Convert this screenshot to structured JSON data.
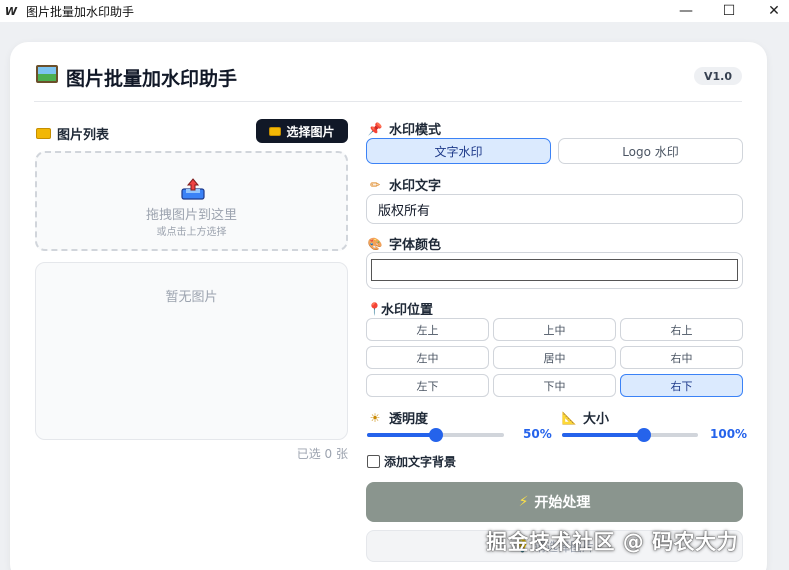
{
  "window": {
    "title": "图片批量加水印助手",
    "icon_glyph": "W",
    "minimize_glyph": "—",
    "maximize_glyph": "☐",
    "close_glyph": "✕"
  },
  "header": {
    "title": "图片批量加水印助手",
    "version": "V1.0"
  },
  "image_list": {
    "label": "图片列表",
    "select_button": "选择图片",
    "dropzone_title": "拖拽图片到这里",
    "dropzone_subtitle": "或点击上方选择",
    "empty_text": "暂无图片",
    "selected_count": "已选 0 张"
  },
  "watermark_mode": {
    "label": "水印模式",
    "options": [
      "文字水印",
      "Logo 水印"
    ],
    "active": "文字水印"
  },
  "watermark_text": {
    "label": "水印文字",
    "value": "版权所有"
  },
  "font_color": {
    "label": "字体颜色",
    "value": "#ffffff"
  },
  "position": {
    "label": "水印位置",
    "options": [
      "左上",
      "上中",
      "右上",
      "左中",
      "居中",
      "右中",
      "左下",
      "下中",
      "右下"
    ],
    "active": "右下"
  },
  "opacity": {
    "label": "透明度",
    "value_text": "50%",
    "value": 0.5
  },
  "size": {
    "label": "大小",
    "value_text": "100%",
    "value": 0.6
  },
  "text_background": {
    "label": "添加文字背景",
    "checked": false
  },
  "start_button": {
    "label": "开始处理"
  },
  "secondary_button": {
    "label": "请选择图片"
  },
  "overlay_watermark": "掘金技术社区 @ 码农大力",
  "colors": {
    "accent": "#2563eb",
    "active_bg": "#dbeafe",
    "start_button_bg": "#8a958e",
    "primary_dark": "#111827"
  }
}
